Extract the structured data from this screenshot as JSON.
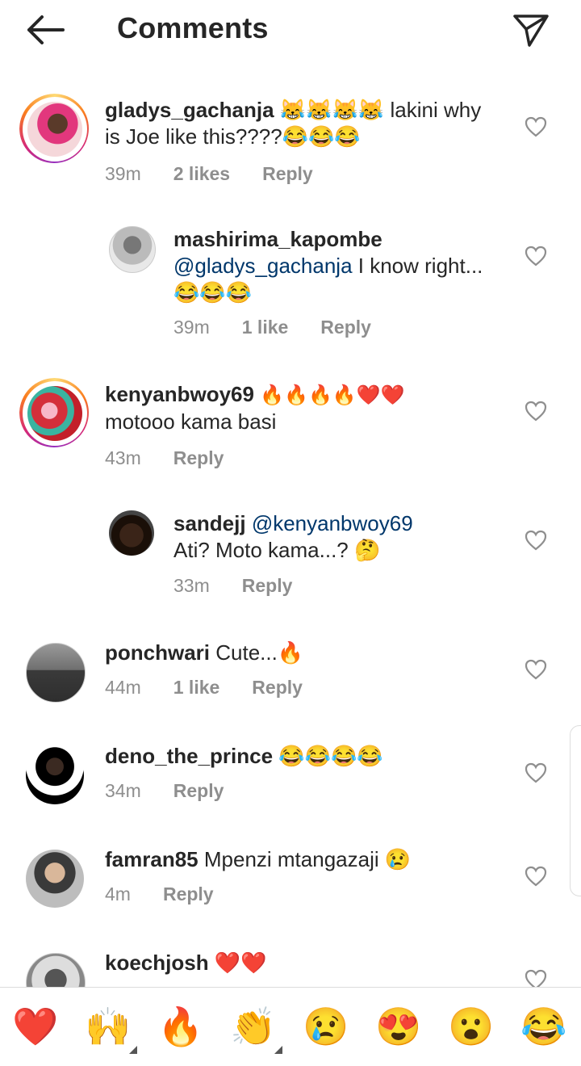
{
  "header": {
    "title": "Comments"
  },
  "comments": [
    {
      "username": "gladys_gachanja",
      "text_line1": "😹😹😹😹 lakini why",
      "text_line2": "is Joe like this????😂😂😂",
      "time": "39m",
      "likes": "2 likes",
      "reply": "Reply"
    },
    {
      "username": "mashirima_kapombe",
      "mention": "@gladys_gachanja",
      "text_after_mention": " I know right...",
      "text_line2": "😂😂😂",
      "time": "39m",
      "likes": "1 like",
      "reply": "Reply"
    },
    {
      "username": "kenyanbwoy69",
      "emoji": "🔥🔥🔥🔥❤️❤️",
      "text_line2": "motooo kama basi",
      "time": "43m",
      "reply": "Reply"
    },
    {
      "username": "sandejj",
      "mention": "@kenyanbwoy69",
      "text_line2": "Ati? Moto kama...? 🤔",
      "time": "33m",
      "reply": "Reply"
    },
    {
      "username": "ponchwari",
      "text": "Cute...🔥",
      "time": "44m",
      "likes": "1 like",
      "reply": "Reply"
    },
    {
      "username": "deno_the_prince",
      "text": "😂😂😂😂",
      "time": "34m",
      "reply": "Reply"
    },
    {
      "username": "famran85",
      "text": "Mpenzi mtangazaji 😢",
      "time": "4m",
      "reply": "Reply"
    },
    {
      "username": "koechjosh",
      "text": "❤️❤️"
    }
  ],
  "reactions": [
    "❤️",
    "🙌",
    "🔥",
    "👏",
    "😢",
    "😍",
    "😮",
    "😂"
  ],
  "colors": {
    "accent_link": "#00376b",
    "meta_gray": "#8e8e8e",
    "heart_red": "#ed1c24"
  },
  "icons": [
    "back-arrow-icon",
    "send-icon",
    "heart-outline-icon"
  ]
}
